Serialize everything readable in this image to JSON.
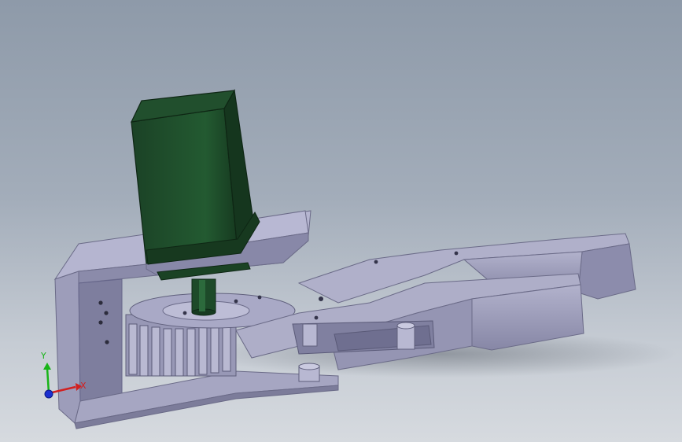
{
  "viewport": {
    "background_top": "#8e9aa9",
    "background_bottom": "#d6dadf"
  },
  "model": {
    "part_color": "#a7a7c3",
    "part_shade": "#7e7e9c",
    "part_dark": "#5e5e7a",
    "motor_color": "#1e4a2a",
    "motor_dark": "#12301b"
  },
  "triad": {
    "x_label": "X",
    "y_label": "Y",
    "x_color": "#d22020",
    "y_color": "#18b418",
    "z_color": "#1a2fd0"
  }
}
